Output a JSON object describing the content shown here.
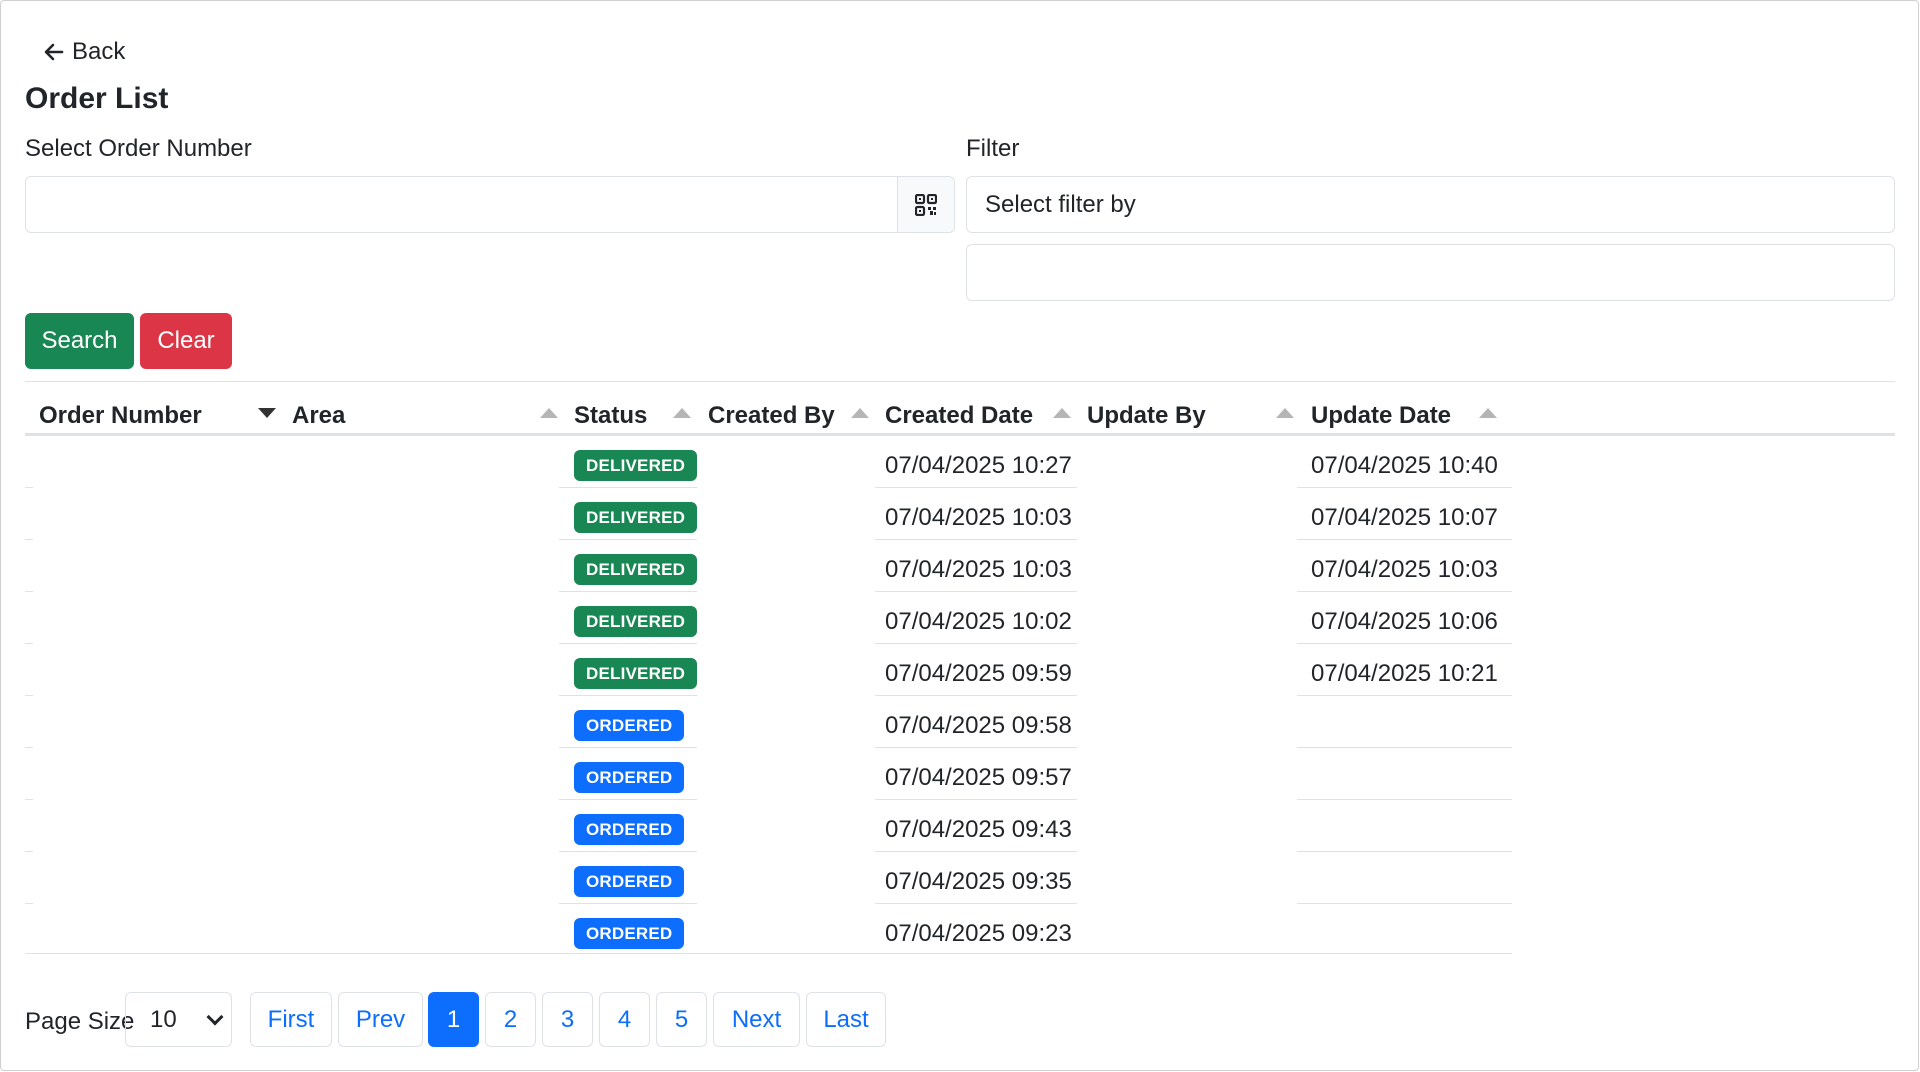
{
  "nav": {
    "back_label": "Back"
  },
  "page_title": "Order List",
  "form": {
    "order_number_label": "Select Order Number",
    "order_number_value": "",
    "filter_label": "Filter",
    "filter_select_value": "Select filter by",
    "filter_value": ""
  },
  "buttons": {
    "search": "Search",
    "clear": "Clear"
  },
  "table": {
    "headers": [
      "Order Number",
      "Area",
      "Status",
      "Created By",
      "Created Date",
      "Update By",
      "Update Date"
    ],
    "sort_state": {
      "Order Number": "descending",
      "Area": "inactive",
      "Status": "inactive",
      "Created By": "inactive",
      "Created Date": "inactive",
      "Update By": "inactive",
      "Update Date": "inactive"
    },
    "rows": [
      {
        "order_number": "",
        "area": "",
        "status": "DELIVERED",
        "created_by": "",
        "created_date": "07/04/2025 10:27",
        "update_by": "",
        "update_date": "07/04/2025 10:40"
      },
      {
        "order_number": "",
        "area": "",
        "status": "DELIVERED",
        "created_by": "",
        "created_date": "07/04/2025 10:03",
        "update_by": "",
        "update_date": "07/04/2025 10:07"
      },
      {
        "order_number": "",
        "area": "",
        "status": "DELIVERED",
        "created_by": "",
        "created_date": "07/04/2025 10:03",
        "update_by": "",
        "update_date": "07/04/2025 10:03"
      },
      {
        "order_number": "",
        "area": "",
        "status": "DELIVERED",
        "created_by": "",
        "created_date": "07/04/2025 10:02",
        "update_by": "",
        "update_date": "07/04/2025 10:06"
      },
      {
        "order_number": "",
        "area": "",
        "status": "DELIVERED",
        "created_by": "",
        "created_date": "07/04/2025 09:59",
        "update_by": "",
        "update_date": "07/04/2025 10:21"
      },
      {
        "order_number": "",
        "area": "",
        "status": "ORDERED",
        "created_by": "",
        "created_date": "07/04/2025 09:58",
        "update_by": "",
        "update_date": ""
      },
      {
        "order_number": "",
        "area": "",
        "status": "ORDERED",
        "created_by": "",
        "created_date": "07/04/2025 09:57",
        "update_by": "",
        "update_date": ""
      },
      {
        "order_number": "",
        "area": "",
        "status": "ORDERED",
        "created_by": "",
        "created_date": "07/04/2025 09:43",
        "update_by": "",
        "update_date": ""
      },
      {
        "order_number": "",
        "area": "",
        "status": "ORDERED",
        "created_by": "",
        "created_date": "07/04/2025 09:35",
        "update_by": "",
        "update_date": ""
      },
      {
        "order_number": "",
        "area": "",
        "status": "ORDERED",
        "created_by": "",
        "created_date": "07/04/2025 09:23",
        "update_by": "",
        "update_date": ""
      }
    ]
  },
  "status_colors": {
    "DELIVERED": "#198754",
    "ORDERED": "#0d6efd"
  },
  "pagination": {
    "page_size_label": "Page Size",
    "page_size_value": "10",
    "first": "First",
    "prev": "Prev",
    "pages": [
      "1",
      "2",
      "3",
      "4",
      "5"
    ],
    "current_page": "1",
    "next": "Next",
    "last": "Last"
  },
  "icons": {
    "back": "arrow-left-icon",
    "scan": "qr-code-icon",
    "sort_desc": "caret-down-icon",
    "sort_inactive": "caret-up-icon",
    "select": "chevron-down-icon"
  }
}
